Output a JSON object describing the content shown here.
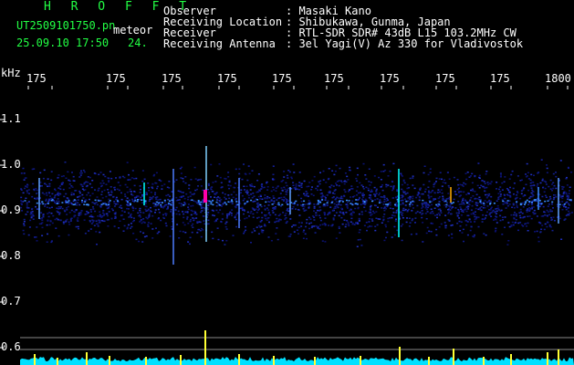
{
  "header": {
    "program": "H R O F F T",
    "filename": "UT2509101750.pn",
    "tag": "meteor",
    "datetime": "25.09.10 17:50",
    "level": "24."
  },
  "station_info": [
    {
      "label": "Observer",
      "value": ": Masaki Kano"
    },
    {
      "label": "Receiving Location",
      "value": ": Shibukawa, Gunma, Japan"
    },
    {
      "label": "Receiver",
      "value": ": RTL-SDR SDR# 43dB L15 103.2MHz CW"
    },
    {
      "label": "Receiving Antenna",
      "value": ": 3el Yagi(V) Az 330 for Vladivostok"
    }
  ],
  "x_axis": {
    "ticks": [
      "175",
      "175",
      "175",
      "175",
      "175",
      "175",
      "175",
      "175",
      "175",
      "1800"
    ]
  },
  "y_axis": {
    "unit": "kHz",
    "ticks": [
      "1.1",
      "1.0",
      "0.9",
      "0.8",
      "0.7",
      "0.6"
    ]
  },
  "colors": {
    "background": "#000000",
    "header_text": "#22ff44",
    "label_text": "#ffffff",
    "noise_band": "#101a7a",
    "signal_bright": "#00ffff",
    "meteor_hot": "#ff00aa",
    "spectrum_fill": "#00e0ff",
    "spectrum_peaks": "#ffff33"
  }
}
